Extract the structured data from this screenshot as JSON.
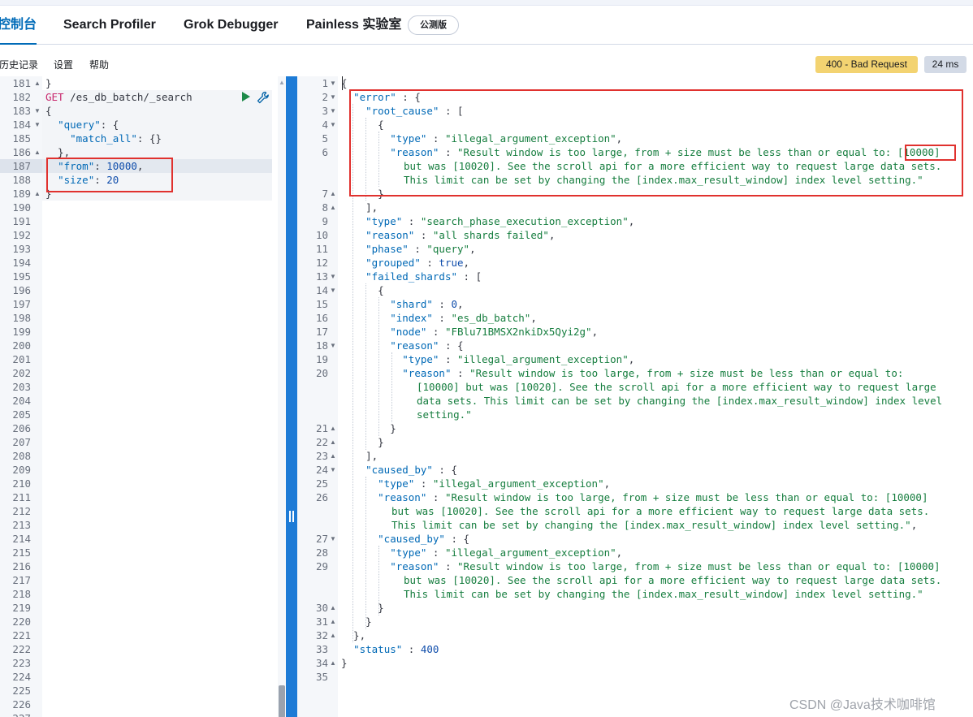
{
  "tabs": [
    {
      "label": "控制台",
      "active": true
    },
    {
      "label": "Search Profiler",
      "active": false
    },
    {
      "label": "Grok Debugger",
      "active": false
    },
    {
      "label": "Painless 实验室",
      "active": false
    }
  ],
  "beta_badge": "公测版",
  "toolbar": {
    "history": "历史记录",
    "settings": "设置",
    "help": "帮助"
  },
  "response_status": "400 - Bad Request",
  "response_time": "24 ms",
  "request_editor": {
    "line_numbers": [
      "181",
      "182",
      "183",
      "184",
      "185",
      "186",
      "187",
      "188",
      "189",
      "190",
      "191",
      "192",
      "193",
      "194",
      "195",
      "196",
      "197",
      "198",
      "199",
      "200",
      "201",
      "202",
      "203",
      "204",
      "205",
      "206",
      "207",
      "208",
      "209",
      "210",
      "211",
      "212",
      "213",
      "214",
      "215",
      "216",
      "217",
      "218",
      "219",
      "220",
      "221",
      "222",
      "223",
      "224",
      "225",
      "226",
      "227"
    ],
    "method": "GET",
    "path": "/es_db_batch/_search",
    "from_value": "10000",
    "size_value": "20"
  },
  "response": {
    "root_reason_line1": "\"Result window is too large, from + size must be less than or equal to: ",
    "root_reason_limit": "[10000]",
    "reason_wrap1": "but was [10020]. See the scroll api for a more efficient way to request large data sets.",
    "reason_wrap2": "This limit can be set by changing the [index.max_result_window] index level setting.\"",
    "type_value": "\"search_phase_execution_exception\"",
    "all_shards_failed": "\"all shards failed\"",
    "phase_value": "\"query\"",
    "grouped_value": "true",
    "shard_value": "0",
    "index_value": "\"es_db_batch\"",
    "node_value": "\"FBlu71BMSX2nkiDx5Qyi2g\"",
    "exception_type": "\"illegal_argument_exception\"",
    "status_value": "400"
  },
  "watermark": "CSDN @Java技术咖啡馆",
  "colors": {
    "accent": "#006bb8",
    "divider": "#1d7bd6",
    "warning": "#f3d371",
    "highlight_box": "#e0312e"
  }
}
